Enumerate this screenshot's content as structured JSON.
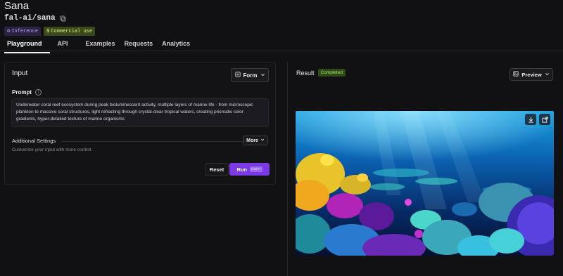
{
  "page": {
    "title": "Sana",
    "model_id": "fal-ai/sana",
    "badges": {
      "inference": "Inference",
      "commercial": "Commercial use"
    }
  },
  "tabs": [
    {
      "label": "Playground",
      "active": true
    },
    {
      "label": "API"
    },
    {
      "label": "Examples"
    },
    {
      "label": "Requests"
    },
    {
      "label": "Analytics"
    }
  ],
  "input": {
    "title": "Input",
    "form_toggle": "Form",
    "prompt_label": "Prompt",
    "prompt_value": "Underwater coral reef ecosystem during peak bioluminescent activity, multiple layers of marine life - from microscopic plankton to massive coral structures, light refracting through crystal-clear tropical waters, creating prismatic color gradients, hyper-detailed texture of marine organisms",
    "additional_settings_title": "Additional Settings",
    "additional_settings_subtitle": "Customize your input with more control.",
    "more_label": "More",
    "reset_label": "Reset",
    "run_label": "Run",
    "run_shortcut": "cmd ↵"
  },
  "result": {
    "title": "Result",
    "status": "Completed",
    "preview_label": "Preview"
  },
  "colors": {
    "accent": "#7c3ae6",
    "status_bg": "#2c4a16",
    "status_text": "#a6e070"
  }
}
